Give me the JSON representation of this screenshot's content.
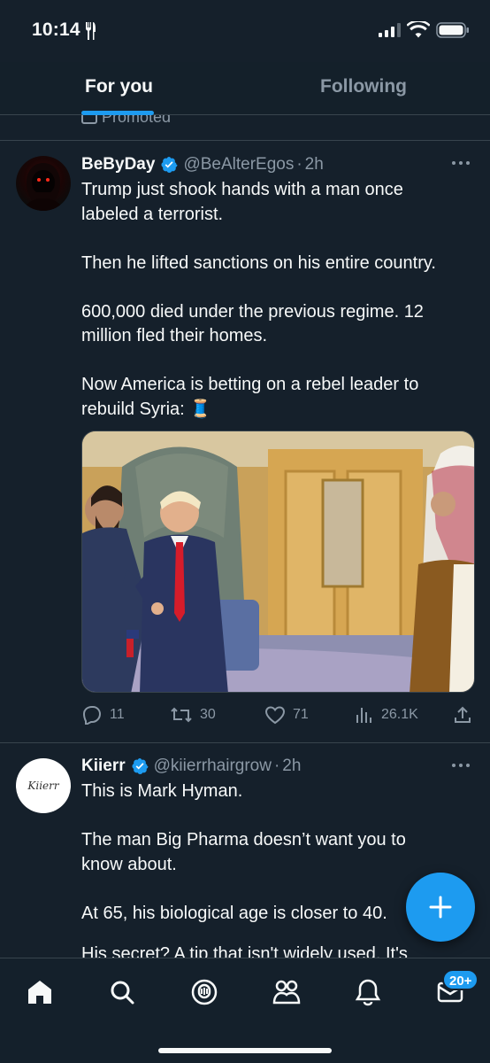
{
  "status_bar": {
    "time": "10:14"
  },
  "tabs": [
    {
      "label": "For you",
      "active": true
    },
    {
      "label": "Following",
      "active": false
    }
  ],
  "promoted_label": "Promoted",
  "tweets": [
    {
      "display_name": "BeByDay",
      "handle": "@BeAlterEgos",
      "time": "2h",
      "text": "Trump just shook hands with a man once labeled a terrorist.\n\nThen he lifted sanctions on his entire country.\n\n600,000 died under the previous regime. 12 million fled their homes.\n\nNow America is betting on a rebel leader to rebuild Syria: 🧵",
      "stats": {
        "replies": "11",
        "reposts": "30",
        "likes": "71",
        "views": "26.1K"
      }
    },
    {
      "display_name": "Kiierr",
      "handle": "@kiierrhairgrow",
      "time": "2h",
      "avatar_text": "Kiierr",
      "text": "This is Mark Hyman.\n\nThe man Big Pharma doesn’t want you to know about.\n\nAt 65, his biological age is closer to 40.",
      "peek_text": "His secret? A tip that isn't widely used. It's"
    }
  ],
  "bottom_nav": {
    "messages_badge": "20+"
  },
  "colors": {
    "background": "#15202b",
    "accent": "#1d9bf0",
    "text_primary": "#f7f9f9",
    "text_secondary": "#8b98a5",
    "divider": "#38444d"
  }
}
